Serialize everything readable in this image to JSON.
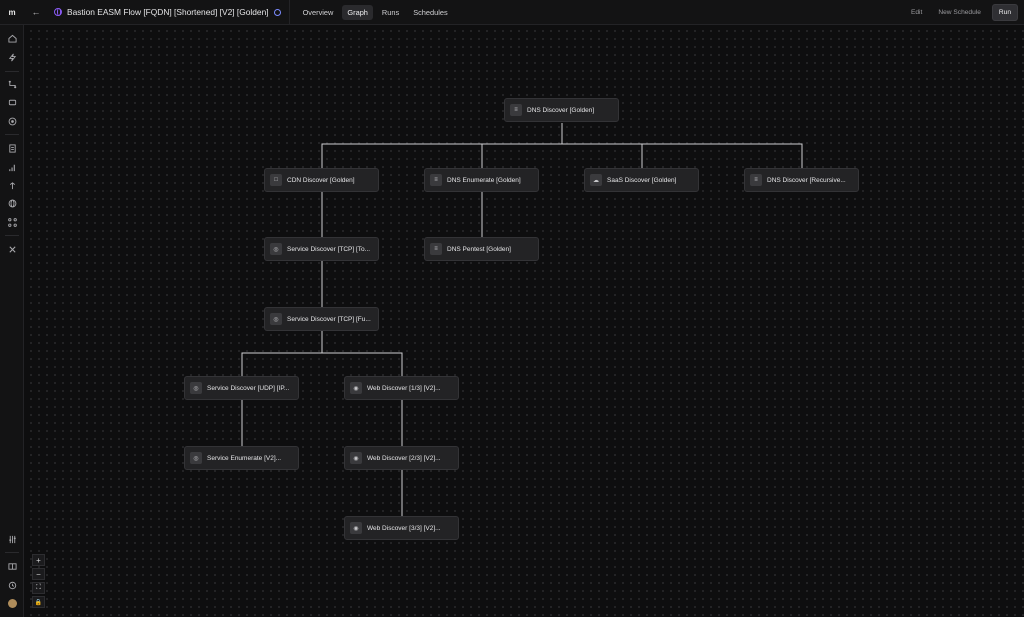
{
  "header": {
    "logo": "m",
    "flow_title": "Bastion EASM Flow [FQDN] [Shortened] [V2] [Golden]",
    "tabs": [
      {
        "label": "Overview",
        "active": false
      },
      {
        "label": "Graph",
        "active": true
      },
      {
        "label": "Runs",
        "active": false
      },
      {
        "label": "Schedules",
        "active": false
      }
    ],
    "actions": {
      "edit": "Edit",
      "new_schedule": "New Schedule",
      "run": "Run"
    }
  },
  "sidebar": {
    "icons": [
      "home-icon",
      "bolt-icon",
      "workflow-icon",
      "puzzle-icon",
      "target-icon",
      "document-icon",
      "chart-icon",
      "tower-icon",
      "globe-icon",
      "network-icon",
      "tools-icon",
      "sliders-icon",
      "book-icon",
      "history-icon",
      "avatar"
    ]
  },
  "graph": {
    "nodes": [
      {
        "id": "dns-discover",
        "label": "DNS Discover [Golden]",
        "icon": "dns-icon"
      },
      {
        "id": "cdn-discover",
        "label": "CDN Discover [Golden]",
        "icon": "square-icon"
      },
      {
        "id": "dns-enumerate",
        "label": "DNS Enumerate [Golden]",
        "icon": "dns-icon"
      },
      {
        "id": "saas-discover",
        "label": "SaaS Discover [Golden]",
        "icon": "cloud-icon"
      },
      {
        "id": "dns-discover-recursive",
        "label": "DNS Discover [Recursive...",
        "icon": "dns-icon"
      },
      {
        "id": "service-discover-tcp-1",
        "label": "Service Discover [TCP] [To...",
        "icon": "radar-icon"
      },
      {
        "id": "dns-pentest",
        "label": "DNS Pentest [Golden]",
        "icon": "dns-icon"
      },
      {
        "id": "service-discover-tcp-2",
        "label": "Service Discover [TCP] [Fu...",
        "icon": "radar-icon"
      },
      {
        "id": "service-discover-udp",
        "label": "Service Discover [UDP] [IP...",
        "icon": "radar-icon"
      },
      {
        "id": "web-discover-1",
        "label": "Web Discover [1/3] [V2]...",
        "icon": "web-icon"
      },
      {
        "id": "service-enumerate",
        "label": "Service Enumerate [V2]...",
        "icon": "radar-icon"
      },
      {
        "id": "web-discover-2",
        "label": "Web Discover [2/3] [V2]...",
        "icon": "web-icon"
      },
      {
        "id": "web-discover-3",
        "label": "Web Discover [3/3] [V2]...",
        "icon": "web-icon"
      }
    ]
  },
  "zoom_controls": {
    "zoom_in": "+",
    "zoom_out": "−",
    "fit": "⛶",
    "lock": "🔒"
  },
  "colors": {
    "accent": "#8b5cf6",
    "canvas": "#0e0e0f",
    "node_bg": "#232325",
    "edge": "#cfcfd2"
  }
}
